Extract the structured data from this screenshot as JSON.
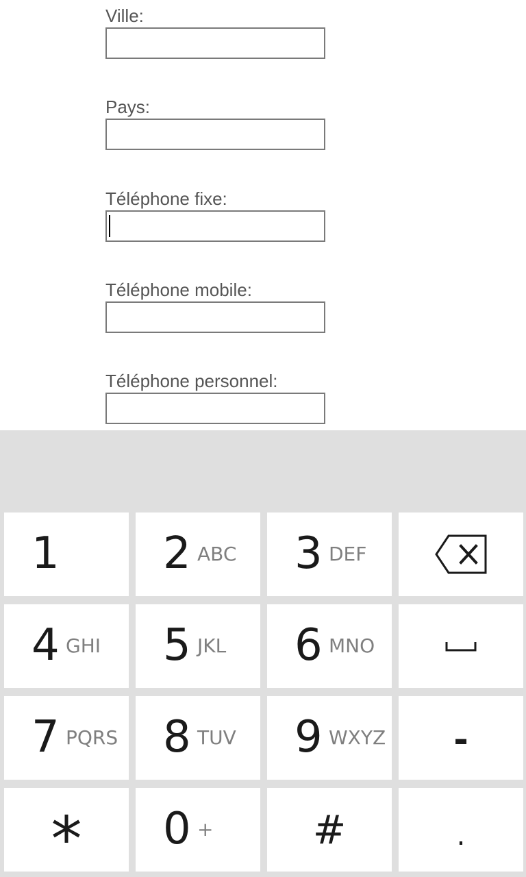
{
  "form": {
    "fields": [
      {
        "label": "Ville:",
        "value": ""
      },
      {
        "label": "Pays:",
        "value": ""
      },
      {
        "label": "Téléphone fixe:",
        "value": "",
        "focused": true
      },
      {
        "label": "Téléphone mobile:",
        "value": ""
      },
      {
        "label": "Téléphone personnel:",
        "value": ""
      }
    ]
  },
  "keyboard": {
    "keys": [
      {
        "digit": "1",
        "letters": ""
      },
      {
        "digit": "2",
        "letters": "ABC"
      },
      {
        "digit": "3",
        "letters": "DEF"
      },
      {
        "digit": "4",
        "letters": "GHI"
      },
      {
        "digit": "5",
        "letters": "JKL"
      },
      {
        "digit": "6",
        "letters": "MNO"
      },
      {
        "digit": "7",
        "letters": "PQRS"
      },
      {
        "digit": "8",
        "letters": "TUV"
      },
      {
        "digit": "9",
        "letters": "WXYZ"
      },
      {
        "digit": "0",
        "letters": "+"
      }
    ],
    "symbols": {
      "star": "*",
      "hash": "#",
      "dash": "-",
      "dot": "."
    },
    "icons": {
      "backspace": "backspace-icon",
      "space": "space-icon"
    }
  }
}
